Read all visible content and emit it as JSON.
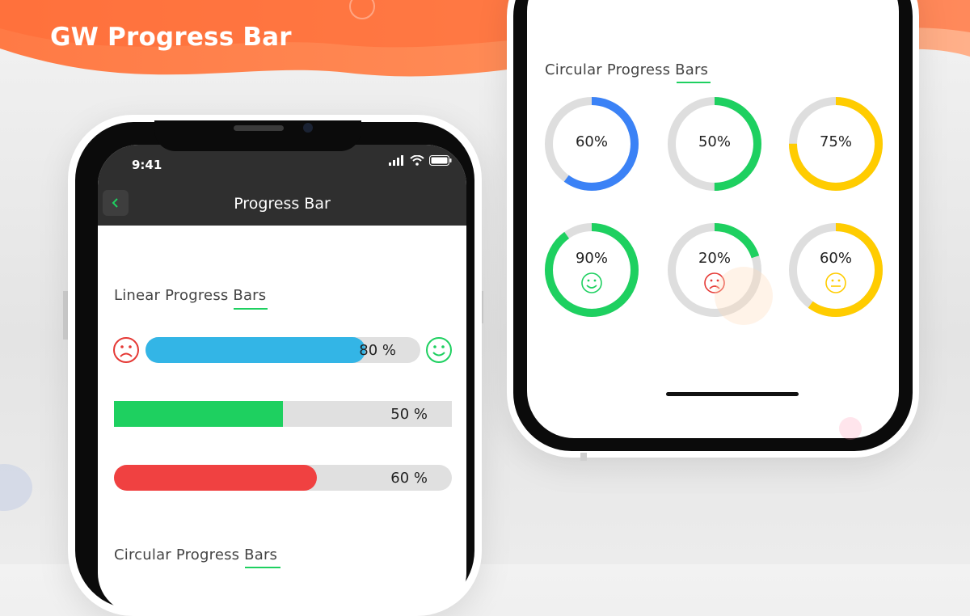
{
  "banner": {
    "title": "GW Progress Bar"
  },
  "phone_left": {
    "status": {
      "time": "9:41"
    },
    "appbar": {
      "title": "Progress Bar",
      "back_icon": "chevron-left-icon"
    },
    "linear_section": {
      "title_a": "Linear Progress ",
      "title_b": "Bars"
    },
    "linear_bars": [
      {
        "percent": 80,
        "label": "80 %",
        "color": "#33b5e6",
        "left_icon": "sad-face-icon",
        "right_icon": "happy-face-icon"
      },
      {
        "percent": 50,
        "label": "50 %",
        "color": "#1ed060"
      },
      {
        "percent": 60,
        "label": "60 %",
        "color": "#f04141"
      }
    ],
    "circular_section": {
      "title_a": "Circular Progress ",
      "title_b": "Bars"
    }
  },
  "phone_right": {
    "circular_section": {
      "title_a": "Circular Progress ",
      "title_b": "Bars"
    },
    "rings": [
      {
        "percent": 60,
        "label": "60%",
        "color": "#3b82f6"
      },
      {
        "percent": 50,
        "label": "50%",
        "color": "#1ed060"
      },
      {
        "percent": 75,
        "label": "75%",
        "color": "#ffcc00"
      },
      {
        "percent": 90,
        "label": "90%",
        "color": "#1ed060",
        "icon": "happy-face-icon"
      },
      {
        "percent": 20,
        "label": "20%",
        "color": "#1ed060",
        "icon": "sad-face-icon",
        "icon_color": "#e53935"
      },
      {
        "percent": 60,
        "label": "60%",
        "color": "#ffcc00",
        "icon": "neutral-face-icon"
      }
    ]
  },
  "colors": {
    "accent_green": "#1ed060",
    "appbar": "#2f2f2f",
    "track": "#e0e0e0",
    "banner_orange": "#ff7a45"
  }
}
